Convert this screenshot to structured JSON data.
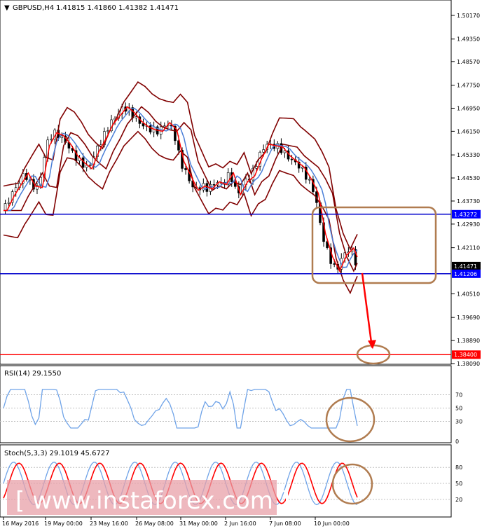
{
  "header": {
    "symbol": "GBPUSD,H4",
    "ohlc": "1.41815 1.41860 1.41382 1.41471"
  },
  "main_price_scale": [
    "1.50170",
    "1.49350",
    "1.48570",
    "1.47750",
    "1.46950",
    "1.46150",
    "1.45330",
    "1.44530",
    "1.43730",
    "1.42930",
    "1.42110",
    "1.40510",
    "1.39690",
    "1.38890",
    "1.38090"
  ],
  "price_badges": [
    {
      "text": "1.43272",
      "color": "#0000ff"
    },
    {
      "text": "1.41471",
      "color": "#000000"
    },
    {
      "text": "1.41206",
      "color": "#0000ff"
    },
    {
      "text": "1.38400",
      "color": "#ff0000"
    }
  ],
  "time_axis": [
    "16 May 2016",
    "19 May 00:00",
    "23 May 16:00",
    "26 May 08:00",
    "31 May 00:00",
    "2 Jun 16:00",
    "7 Jun 08:00",
    "10 Jun 00:00"
  ],
  "rsi": {
    "label": "RSI(14) 29.1550",
    "levels": [
      "70",
      "50",
      "30",
      "0"
    ]
  },
  "stoch": {
    "label": "Stoch(5,3,3) 29.1019 45.6727",
    "levels": [
      "80",
      "50",
      "20"
    ]
  },
  "watermark": "[ www.instaforex.com ]",
  "colors": {
    "support": "#0000cc",
    "target": "#ff0000",
    "highlight": "#b07c50",
    "bollinger": "#800000",
    "ma_fast": "#ff0000",
    "ma_slow": "#4a7fd8",
    "rsi_line": "#6fa3e8"
  },
  "chart_data": {
    "type": "candlestick",
    "symbol": "GBPUSD",
    "timeframe": "H4",
    "ohlc_last": {
      "open": 1.41815,
      "high": 1.4186,
      "low": 1.41382,
      "close": 1.41471
    },
    "horizontal_levels": [
      1.43272,
      1.41206,
      1.384
    ],
    "close_path": [
      {
        "t": 0,
        "p": 1.434
      },
      {
        "t": 2,
        "p": 1.439
      },
      {
        "t": 4,
        "p": 1.443
      },
      {
        "t": 6,
        "p": 1.447
      },
      {
        "t": 8,
        "p": 1.4425
      },
      {
        "t": 10,
        "p": 1.442
      },
      {
        "t": 12,
        "p": 1.4565
      },
      {
        "t": 14,
        "p": 1.461
      },
      {
        "t": 16,
        "p": 1.46
      },
      {
        "t": 18,
        "p": 1.457
      },
      {
        "t": 20,
        "p": 1.453
      },
      {
        "t": 22,
        "p": 1.4505
      },
      {
        "t": 24,
        "p": 1.4485
      },
      {
        "t": 26,
        "p": 1.4545
      },
      {
        "t": 28,
        "p": 1.459
      },
      {
        "t": 30,
        "p": 1.464
      },
      {
        "t": 32,
        "p": 1.467
      },
      {
        "t": 34,
        "p": 1.47
      },
      {
        "t": 36,
        "p": 1.468
      },
      {
        "t": 38,
        "p": 1.465
      },
      {
        "t": 40,
        "p": 1.463
      },
      {
        "t": 42,
        "p": 1.462
      },
      {
        "t": 44,
        "p": 1.4615
      },
      {
        "t": 46,
        "p": 1.4645
      },
      {
        "t": 48,
        "p": 1.462
      },
      {
        "t": 50,
        "p": 1.451
      },
      {
        "t": 52,
        "p": 1.446
      },
      {
        "t": 54,
        "p": 1.441
      },
      {
        "t": 56,
        "p": 1.4425
      },
      {
        "t": 58,
        "p": 1.4415
      },
      {
        "t": 60,
        "p": 1.444
      },
      {
        "t": 62,
        "p": 1.443
      },
      {
        "t": 64,
        "p": 1.447
      },
      {
        "t": 66,
        "p": 1.4395
      },
      {
        "t": 68,
        "p": 1.444
      },
      {
        "t": 70,
        "p": 1.446
      },
      {
        "t": 72,
        "p": 1.452
      },
      {
        "t": 74,
        "p": 1.457
      },
      {
        "t": 76,
        "p": 1.4565
      },
      {
        "t": 78,
        "p": 1.456
      },
      {
        "t": 80,
        "p": 1.453
      },
      {
        "t": 82,
        "p": 1.451
      },
      {
        "t": 84,
        "p": 1.449
      },
      {
        "t": 86,
        "p": 1.445
      },
      {
        "t": 88,
        "p": 1.44
      },
      {
        "t": 90,
        "p": 1.426
      },
      {
        "t": 92,
        "p": 1.418
      },
      {
        "t": 94,
        "p": 1.413
      },
      {
        "t": 96,
        "p": 1.4185
      },
      {
        "t": 98,
        "p": 1.421
      },
      {
        "t": 100,
        "p": 1.4147
      }
    ],
    "forecast_arrow": {
      "from": 1.4147,
      "to": 1.384
    },
    "rsi": {
      "value": 29.155,
      "period": 14
    },
    "stoch": {
      "k": 29.1019,
      "d": 45.6727,
      "params": "5,3,3"
    }
  }
}
